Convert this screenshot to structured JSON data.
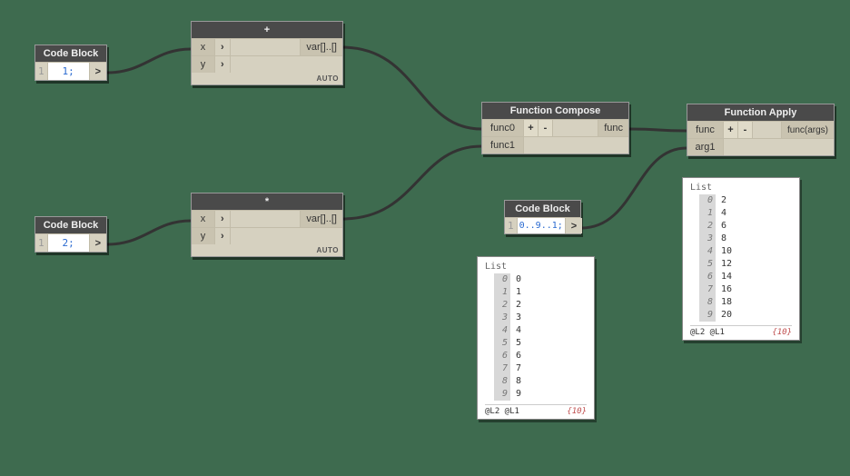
{
  "nodes": {
    "codeblock1": {
      "title": "Code Block",
      "line": "1",
      "value": "1;",
      "out": ">"
    },
    "codeblock2": {
      "title": "Code Block",
      "line": "1",
      "value": "2;",
      "out": ">"
    },
    "codeblock3": {
      "title": "Code Block",
      "line": "1",
      "value": "0..9..1;",
      "out": ">"
    },
    "plus": {
      "title": "+",
      "in1": "x",
      "in2": "y",
      "out": "var[]..[]",
      "lacing": "AUTO"
    },
    "mult": {
      "title": "*",
      "in1": "x",
      "in2": "y",
      "out": "var[]..[]",
      "lacing": "AUTO"
    },
    "compose": {
      "title": "Function Compose",
      "in1": "func0",
      "in2": "func1",
      "out": "func",
      "plus": "+",
      "minus": "-"
    },
    "apply": {
      "title": "Function Apply",
      "in1": "func",
      "in2": "arg1",
      "out": "func(args)",
      "plus": "+",
      "minus": "-"
    }
  },
  "previews": {
    "range": {
      "label": "List",
      "items": [
        [
          0,
          0
        ],
        [
          1,
          1
        ],
        [
          2,
          2
        ],
        [
          3,
          3
        ],
        [
          4,
          4
        ],
        [
          5,
          5
        ],
        [
          6,
          6
        ],
        [
          7,
          7
        ],
        [
          8,
          8
        ],
        [
          9,
          9
        ]
      ],
      "footL": "@L2 @L1",
      "footR": "{10}"
    },
    "result": {
      "label": "List",
      "items": [
        [
          0,
          2
        ],
        [
          1,
          4
        ],
        [
          2,
          6
        ],
        [
          3,
          8
        ],
        [
          4,
          10
        ],
        [
          5,
          12
        ],
        [
          6,
          14
        ],
        [
          7,
          16
        ],
        [
          8,
          18
        ],
        [
          9,
          20
        ]
      ],
      "footL": "@L2 @L1",
      "footR": "{10}"
    }
  }
}
